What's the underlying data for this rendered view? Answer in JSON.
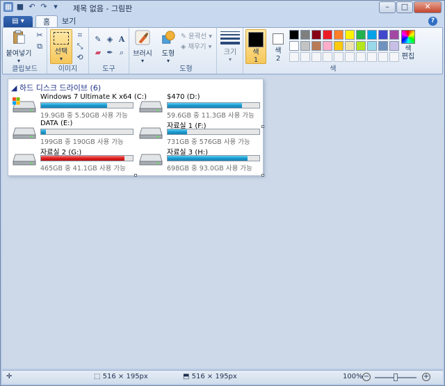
{
  "title": "제목 없음 - 그림판",
  "tabs": {
    "home": "홈",
    "view": "보기"
  },
  "ribbon": {
    "clipboard": {
      "paste": "붙여넣기",
      "label": "클립보드"
    },
    "image": {
      "select": "선택",
      "label": "이미지"
    },
    "tools": {
      "label": "도구"
    },
    "brushes": {
      "label": "브러시"
    },
    "shapes": {
      "shape": "도형",
      "outline": "윤곽선",
      "fill": "채우기",
      "label": "도형"
    },
    "size": {
      "label": "크기"
    },
    "colors": {
      "color1": "색\n1",
      "color2": "색\n2",
      "edit": "색\n편집",
      "label": "색",
      "palette_row1": [
        "#000000",
        "#7f7f7f",
        "#880015",
        "#ed1c24",
        "#ff7f27",
        "#fff200",
        "#22b14c",
        "#00a2e8",
        "#3f48cc",
        "#a349a4"
      ],
      "palette_row2": [
        "#ffffff",
        "#c3c3c3",
        "#b97a57",
        "#ffaec9",
        "#ffc90e",
        "#efe4b0",
        "#b5e61d",
        "#99d9ea",
        "#7092be",
        "#c8bfe7"
      ]
    }
  },
  "canvas": {
    "header": "하드 디스크 드라이브 (6)",
    "drives": [
      {
        "name": "Windows 7 Ultimate K x64 (C:)",
        "free": "19.9GB 중 5.50GB 사용 가능",
        "used": 0.72,
        "color": "blue",
        "windows": true
      },
      {
        "name": "$470 (D:)",
        "free": "59.6GB 중 11.3GB 사용 가능",
        "used": 0.81,
        "color": "blue"
      },
      {
        "name": "DATA (E:)",
        "free": "199GB 중 190GB 사용 가능",
        "used": 0.05,
        "color": "blue"
      },
      {
        "name": "자료실 1 (F:)",
        "free": "731GB 중 576GB 사용 가능",
        "used": 0.21,
        "color": "blue"
      },
      {
        "name": "자료실 2 (G:)",
        "free": "465GB 중 41.1GB 사용 가능",
        "used": 0.91,
        "color": "red"
      },
      {
        "name": "자료실 3 (H:)",
        "free": "698GB 중 93.0GB 사용 가능",
        "used": 0.87,
        "color": "blue"
      }
    ]
  },
  "status": {
    "selection_size": "516 × 195px",
    "image_size": "516 × 195px",
    "zoom": "100%"
  }
}
